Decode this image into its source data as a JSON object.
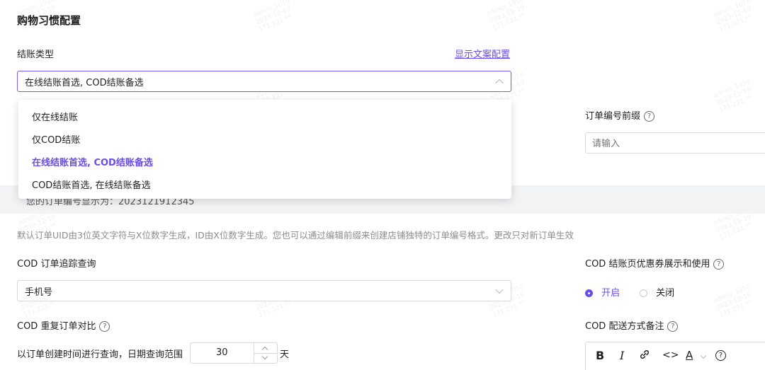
{
  "section": {
    "title": "购物习惯配置"
  },
  "checkout": {
    "label": "结账类型",
    "link": "显示文案配置",
    "selected": "在线结账首选, COD结账备选",
    "options": [
      "仅在线结账",
      "仅COD结账",
      "在线结账首选, COD结账备选",
      "COD结账首选, 在线结账备选"
    ]
  },
  "order_prefix": {
    "label": "订单编号前缀",
    "placeholder": "请输入"
  },
  "preview_partial": "您的订单编号显示为：2023121912345",
  "description": "默认订单UID由3位英文字符与X位数字生成，ID由X位数字生成。您也可以通过编辑前缀来创建店铺独特的订单编号格式。更改只对新订单生效",
  "cod_tracking": {
    "label": "COD 订单追踪查询",
    "value": "手机号"
  },
  "cod_coupon": {
    "label": "COD 结账页优惠券展示和使用",
    "on_label": "开启",
    "off_label": "关闭"
  },
  "cod_duplicate": {
    "label": "COD 重复订单对比",
    "query_text": "以订单创建时间进行查询，日期查询范围",
    "days": "30",
    "unit": "天"
  },
  "cod_shipping_note": {
    "label": "COD 配送方式备注"
  },
  "editor_toolbar": {
    "bold": "B",
    "italic": "I",
    "code": "<>",
    "color": "A"
  },
  "help_symbol": "?",
  "colors": {
    "accent": "#6b4ce6",
    "band": "#f2f3f5"
  }
}
